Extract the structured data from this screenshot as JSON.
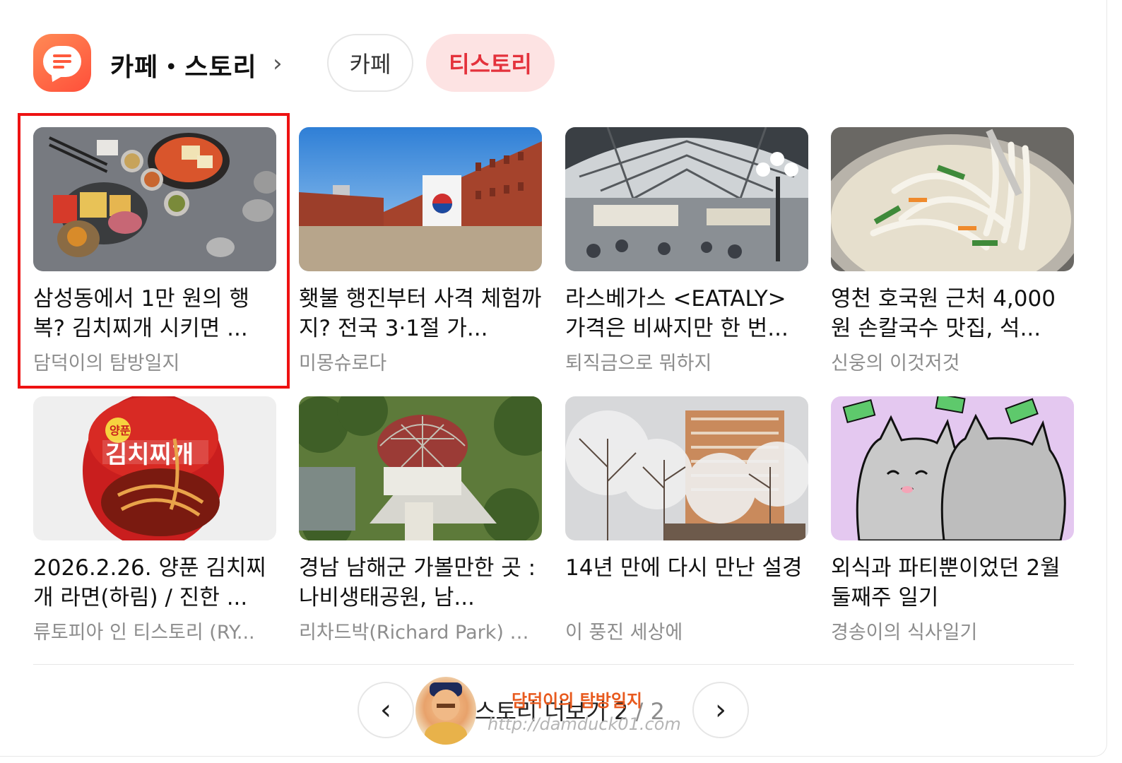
{
  "header": {
    "app_icon": "chat-bubble-icon",
    "title": "카페・스토리",
    "chevron": "›",
    "tabs": [
      {
        "label": "카페",
        "active": false
      },
      {
        "label": "티스토리",
        "active": true
      }
    ]
  },
  "colors": {
    "accent": "#e4323c",
    "active_tab_bg": "#fde3e3",
    "highlight_border": "#ee1212",
    "app_icon": "#ff5a3c"
  },
  "cards": [
    {
      "title": "삼성동에서 1만 원의 행복? 김치찌개 시키면 ...",
      "source": "담덕이의 탐방일지",
      "image": "kimchi-stew-table-photo",
      "highlighted": true
    },
    {
      "title": "횃불 행진부터 사격 체험까지? 전국 3·1절 가...",
      "source": "미몽슈로다",
      "image": "red-brick-prison-photo"
    },
    {
      "title": "라스베가스 <EATALY> 가격은 비싸지만 한 번...",
      "source": "퇴직금으로 뭐하지",
      "image": "eataly-market-hall-photo"
    },
    {
      "title": "영천 호국원 근처 4,000원 손칼국수 맛집, 석...",
      "source": "신웅의 이것저것",
      "image": "kalguksu-noodle-photo"
    },
    {
      "title": "2026.2.26. 양푼 김치찌개 라면(하림) / 진한 ...",
      "source": "류토피아 인 티스토리 (RY...",
      "image": "kimchi-ramen-cup-photo",
      "image_text": "김치찌개"
    },
    {
      "title": "경남 남해군 가볼만한 곳 : 나비생태공원, 남...",
      "source": "리차드박(Richard Park) 블...",
      "image": "butterfly-park-aerial-photo"
    },
    {
      "title": "14년 만에 다시 만난 설경",
      "source": "이 풍진 세상에",
      "image": "snowy-trees-apartment-photo"
    },
    {
      "title": "외식과 파티뿐이었던 2월 둘째주 일기",
      "source": "경송이의 식사일기",
      "image": "cat-cartoon-money-illustration"
    }
  ],
  "footer": {
    "prev": "‹",
    "next": "›",
    "more_label": "스토리 더보기",
    "page": "2",
    "total": "/ 2"
  },
  "watermark": {
    "title": "담덕이의 탐방일지",
    "url": "http://damduck01.com"
  }
}
